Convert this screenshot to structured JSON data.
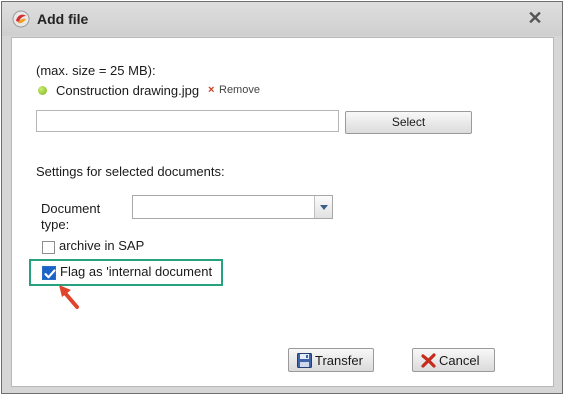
{
  "dialog": {
    "title": "Add file",
    "close_glyph": "✕"
  },
  "upload": {
    "max_size_text": "(max. size = 25 MB):",
    "file_name": "Construction drawing.jpg",
    "remove_label": "Remove",
    "remove_glyph": "×",
    "field_value": "",
    "select_label": "Select"
  },
  "settings": {
    "heading": "Settings for selected documents:",
    "doc_type_label": "Document type:",
    "doc_type_value": "",
    "archive_label": "archive in SAP",
    "archive_checked": false,
    "internal_label": "Flag as 'internal document",
    "internal_checked": true
  },
  "buttons": {
    "transfer_label": "Transfer",
    "cancel_label": "Cancel"
  },
  "colors": {
    "highlight_box": "#27a27e",
    "arrow": "#e0452c",
    "checkbox_checked": "#1a63c8",
    "file_status_dot": "#8cc42a"
  },
  "icons": {
    "app": "app-logo-icon",
    "file_status": "green-dot-icon",
    "remove": "red-x-icon",
    "transfer": "floppy-disk-icon",
    "cancel": "red-x-icon",
    "annotation": "red-arrow-icon"
  }
}
